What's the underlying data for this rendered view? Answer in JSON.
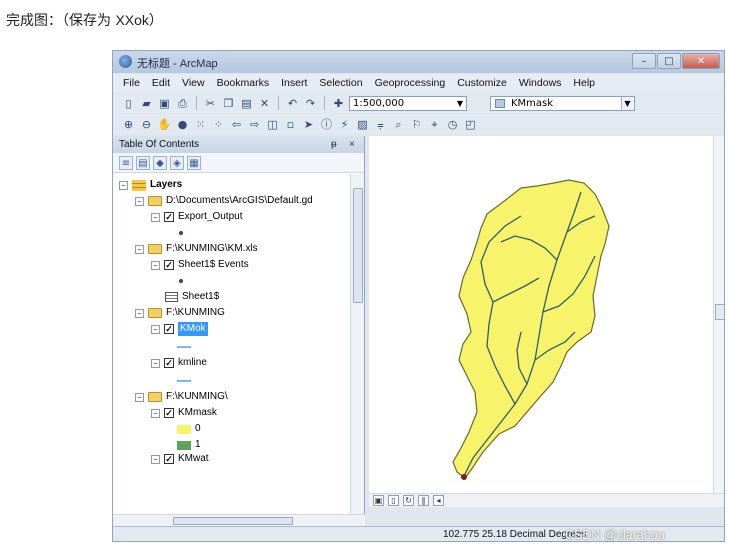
{
  "caption": {
    "prefix": "完成图：（保存为 ",
    "filename": "XXok",
    "suffix": "）"
  },
  "window": {
    "title": "无标题 - ArcMap",
    "buttons": {
      "minimize": "–",
      "maximize": "□",
      "close": "✕"
    }
  },
  "menu": [
    "File",
    "Edit",
    "View",
    "Bookmarks",
    "Insert",
    "Selection",
    "Geoprocessing",
    "Customize",
    "Windows",
    "Help"
  ],
  "toolbar": {
    "scale_value": "1:500,000",
    "layer_select": "KMmask"
  },
  "toc": {
    "title": "Table Of Contents",
    "pin": "ᵽ",
    "close": "×",
    "root": "Layers",
    "groups": [
      {
        "path": "D:\\Documents\\ArcGIS\\Default.gd",
        "children": [
          "Export_Output"
        ]
      },
      {
        "path": "F:\\KUNMING\\KM.xls",
        "children": [
          "Sheet1$ Events",
          "Sheet1$"
        ]
      },
      {
        "path": "F:\\KUNMING",
        "children": [
          "KMok",
          "kmline"
        ]
      },
      {
        "path": "F:\\KUNMING\\",
        "children": [
          "KMmask",
          "KMwat"
        ]
      }
    ],
    "legend_values": [
      "0",
      "1"
    ]
  },
  "status": {
    "coords": "102.775  25.18 Decimal Degrees"
  },
  "watermark": "CSDN @clarahou",
  "colors": {
    "watershed_fill": "#f7f36b",
    "watershed_stroke": "#6b6b2a",
    "stream": "#2f5f6c",
    "mask_0": "#f7f36b",
    "mask_1": "#5ea35e",
    "selection": "#3399ff"
  }
}
